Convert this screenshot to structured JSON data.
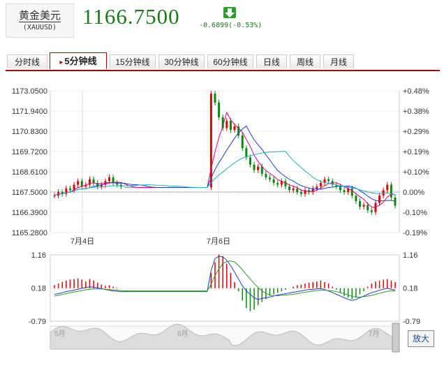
{
  "header": {
    "name": "黄金美元",
    "code": "(XAUUSD)",
    "price": "1166.7500",
    "change": "-0.6899(-0.53%)",
    "arrow_icon": "down-arrow-icon",
    "change_color": "#1a7a1a"
  },
  "tabs": [
    "分时线",
    "5分钟线",
    "15分钟线",
    "30分钟线",
    "60分钟线",
    "日线",
    "周线",
    "月线"
  ],
  "active_tab": "5分钟线",
  "zoom_label": "放大",
  "navigator": {
    "labels": [
      "5月",
      "6月",
      "7月"
    ]
  },
  "colors": {
    "up": "#e00000",
    "down": "#0a8a0a",
    "ma5": "#e0007a",
    "ma10": "#1f3fd0",
    "ma20": "#20b0c0",
    "border": "#b30000"
  },
  "chart_data": [
    {
      "type": "candlestick",
      "y_left_ticks": [
        "1173.0500",
        "1171.9400",
        "1170.8300",
        "1169.7200",
        "1168.6100",
        "1167.5000",
        "1166.3900",
        "1165.2800"
      ],
      "y_right_ticks": [
        "+0.48%",
        "+0.38%",
        "+0.29%",
        "+0.19%",
        "+0.10%",
        "0.00%",
        "-0.10%",
        "-0.19%"
      ],
      "x_ticks": [
        "7月4日",
        "7月6日"
      ],
      "ylim": [
        1165.28,
        1173.05
      ],
      "prev_close": 1167.5,
      "close_series": [
        1167.3,
        1167.5,
        1167.4,
        1167.7,
        1167.6,
        1167.9,
        1168.1,
        1167.8,
        1167.9,
        1168.2,
        1168.0,
        1167.8,
        1167.9,
        1168.1,
        1168.3,
        1168.0,
        1167.9,
        1167.8,
        1167.75,
        1167.75,
        1167.75,
        1167.75,
        1167.75,
        1167.75,
        1167.75,
        1167.75,
        1167.75,
        1167.75,
        1167.75,
        1167.75,
        1167.75,
        1167.75,
        1167.75,
        1167.75,
        1167.75,
        1167.75,
        1167.75,
        1167.75,
        1167.75,
        1167.75,
        1172.9,
        1172.4,
        1171.6,
        1171.0,
        1171.4,
        1170.9,
        1171.1,
        1170.6,
        1169.9,
        1169.4,
        1169.0,
        1168.7,
        1168.9,
        1168.5,
        1168.3,
        1168.2,
        1168.0,
        1167.9,
        1168.1,
        1167.8,
        1167.6,
        1167.7,
        1167.5,
        1167.4,
        1167.6,
        1167.5,
        1167.7,
        1167.8,
        1168.0,
        1168.2,
        1168.1,
        1167.9,
        1167.8,
        1167.6,
        1167.5,
        1167.7,
        1167.3,
        1167.0,
        1166.7,
        1166.8,
        1166.5,
        1166.4,
        1166.9,
        1167.3,
        1167.6,
        1167.9,
        1167.2,
        1166.75
      ]
    },
    {
      "type": "macd",
      "y_ticks": [
        "1.16",
        "0.18",
        "-0.79"
      ],
      "ylim": [
        -0.79,
        1.16
      ],
      "hist": [
        0.1,
        0.15,
        0.2,
        0.25,
        0.28,
        0.3,
        0.32,
        0.28,
        0.22,
        0.3,
        0.25,
        0.18,
        0.12,
        0.08,
        0.1,
        0.05,
        0.02,
        0.0,
        0.0,
        0.0,
        0.0,
        0.0,
        0.0,
        0.0,
        0.0,
        0.0,
        0.0,
        0.0,
        0.0,
        0.0,
        0.0,
        0.0,
        0.0,
        0.0,
        0.0,
        0.0,
        0.0,
        0.0,
        0.0,
        0.0,
        0.5,
        0.85,
        1.1,
        1.05,
        0.8,
        0.5,
        0.2,
        -0.1,
        -0.4,
        -0.65,
        -0.75,
        -0.7,
        -0.55,
        -0.45,
        -0.35,
        -0.25,
        -0.2,
        -0.15,
        -0.1,
        -0.05,
        0.0,
        0.05,
        0.1,
        0.12,
        0.15,
        0.18,
        0.2,
        0.22,
        0.25,
        0.2,
        0.15,
        0.05,
        -0.05,
        -0.15,
        -0.25,
        -0.3,
        -0.35,
        -0.3,
        -0.2,
        -0.1,
        0.05,
        0.15,
        0.22,
        0.25,
        0.28,
        0.3,
        0.25,
        0.2
      ],
      "dif": [
        0.0,
        0.02,
        0.05,
        0.08,
        0.1,
        0.12,
        0.15,
        0.18,
        0.2,
        0.22,
        0.21,
        0.19,
        0.17,
        0.14,
        0.12,
        0.1,
        0.09,
        0.08,
        0.08,
        0.08,
        0.08,
        0.08,
        0.08,
        0.08,
        0.08,
        0.08,
        0.08,
        0.08,
        0.08,
        0.08,
        0.08,
        0.08,
        0.08,
        0.08,
        0.08,
        0.08,
        0.08,
        0.08,
        0.08,
        0.08,
        0.7,
        1.05,
        1.12,
        1.1,
        1.0,
        0.85,
        0.65,
        0.45,
        0.25,
        0.1,
        0.0,
        -0.1,
        -0.15,
        -0.12,
        -0.1,
        -0.08,
        -0.05,
        -0.02,
        0.0,
        0.02,
        0.04,
        0.06,
        0.08,
        0.1,
        0.12,
        0.14,
        0.15,
        0.16,
        0.17,
        0.14,
        0.1,
        0.05,
        0.0,
        -0.05,
        -0.1,
        -0.15,
        -0.18,
        -0.15,
        -0.1,
        -0.05,
        0.0,
        0.05,
        0.08,
        0.12,
        0.15,
        0.18,
        0.15,
        0.12
      ],
      "dea": [
        -0.05,
        -0.03,
        0.0,
        0.02,
        0.05,
        0.07,
        0.09,
        0.11,
        0.13,
        0.15,
        0.16,
        0.16,
        0.16,
        0.15,
        0.14,
        0.13,
        0.12,
        0.11,
        0.1,
        0.1,
        0.1,
        0.1,
        0.1,
        0.1,
        0.1,
        0.1,
        0.1,
        0.1,
        0.1,
        0.1,
        0.1,
        0.1,
        0.1,
        0.1,
        0.1,
        0.1,
        0.1,
        0.1,
        0.1,
        0.1,
        0.3,
        0.55,
        0.75,
        0.9,
        0.97,
        0.98,
        0.95,
        0.85,
        0.72,
        0.58,
        0.45,
        0.32,
        0.2,
        0.1,
        0.03,
        -0.02,
        -0.04,
        -0.04,
        -0.03,
        -0.02,
        -0.01,
        0.0,
        0.02,
        0.04,
        0.06,
        0.08,
        0.1,
        0.11,
        0.12,
        0.12,
        0.11,
        0.1,
        0.08,
        0.05,
        0.02,
        -0.02,
        -0.06,
        -0.08,
        -0.08,
        -0.07,
        -0.05,
        -0.03,
        0.0,
        0.03,
        0.06,
        0.09,
        0.1,
        0.1
      ]
    }
  ]
}
